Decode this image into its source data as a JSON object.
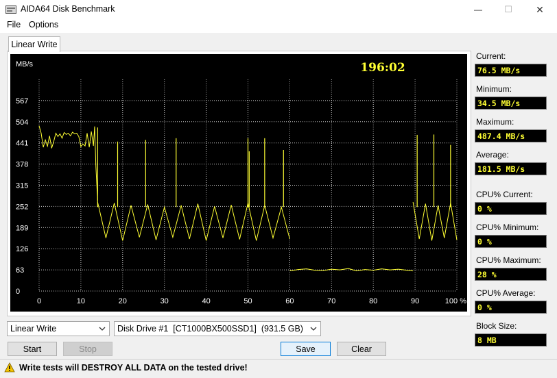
{
  "window": {
    "title": "AIDA64 Disk Benchmark",
    "controls": {
      "minimize": "—",
      "maximize": "☐",
      "close": "✕"
    }
  },
  "menu": {
    "file": "File",
    "options": "Options"
  },
  "tab": {
    "label": "Linear Write"
  },
  "chart_data": {
    "type": "line",
    "ylabel": "MB/s",
    "timer": "196:02",
    "ylim": [
      0,
      630
    ],
    "xlim": [
      0,
      100
    ],
    "yticks": [
      "567",
      "504",
      "441",
      "378",
      "315",
      "252",
      "189",
      "126",
      "63",
      "0"
    ],
    "ytick_values": [
      567,
      504,
      441,
      378,
      315,
      252,
      189,
      126,
      63,
      0
    ],
    "xticks": [
      "0",
      "10",
      "20",
      "30",
      "40",
      "50",
      "60",
      "70",
      "80",
      "90",
      "100 %"
    ],
    "xtick_values": [
      0,
      10,
      20,
      30,
      40,
      50,
      60,
      70,
      80,
      90,
      100
    ],
    "grid": true,
    "colors": {
      "background": "#000000",
      "grid": "#ffffff",
      "line": "#ffff33",
      "timer": "#ffff33",
      "axis_text": "#ffffff"
    },
    "series": [
      {
        "segments": [
          {
            "x": [
              0,
              0.5,
              1,
              1.5,
              2,
              2.5,
              3,
              3.5,
              4,
              4.5,
              5,
              5.5,
              6,
              6.5,
              7,
              7.5,
              8,
              8.5,
              9,
              9.5,
              10,
              10.5,
              11,
              11.5,
              12,
              12.5,
              13,
              13.3,
              13.6,
              14.0
            ],
            "y": [
              492,
              470,
              428,
              450,
              431,
              462,
              425,
              445,
              470,
              460,
              468,
              455,
              472,
              466,
              470,
              462,
              473,
              468,
              470,
              460,
              430,
              438,
              432,
              470,
              428,
              475,
              432,
              490,
              370,
              270
            ]
          },
          {
            "x": [
              14,
              16,
              18,
              20,
              22,
              24,
              26,
              28,
              30,
              32,
              34,
              36,
              38,
              40,
              42,
              44,
              46,
              48,
              50,
              52,
              54,
              56,
              58,
              60
            ],
            "y": [
              265,
              158,
              262,
              150,
              255,
              160,
              258,
              152,
              250,
              160,
              255,
              155,
              260,
              150,
              252,
              158,
              256,
              154,
              262,
              150,
              255,
              158,
              250,
              155
            ]
          },
          {
            "x": [
              60,
              62,
              64,
              66,
              68,
              70,
              72,
              74,
              76,
              78,
              80,
              82,
              84,
              86,
              88,
              89.5
            ],
            "y": [
              60,
              64,
              66,
              62,
              61,
              65,
              63,
              67,
              60,
              64,
              62,
              66,
              63,
              65,
              62,
              60
            ]
          },
          {
            "x": [
              89.5,
              91,
              92.5,
              94,
              95.5,
              97,
              98.5,
              100
            ],
            "y": [
              265,
              155,
              260,
              150,
              255,
              158,
              262,
              152
            ]
          }
        ],
        "spikes": [
          {
            "x": 14.0,
            "y": 487
          },
          {
            "x": 18.8,
            "y": 445
          },
          {
            "x": 25.5,
            "y": 450
          },
          {
            "x": 32.8,
            "y": 455
          },
          {
            "x": 50.0,
            "y": 455
          },
          {
            "x": 50.3,
            "y": 416
          },
          {
            "x": 54.0,
            "y": 455
          },
          {
            "x": 58.5,
            "y": 420
          },
          {
            "x": 90.5,
            "y": 465
          },
          {
            "x": 94.5,
            "y": 466
          },
          {
            "x": 98.5,
            "y": 435
          }
        ]
      }
    ]
  },
  "stats": {
    "current": {
      "label": "Current:",
      "value": "76.5 MB/s"
    },
    "minimum": {
      "label": "Minimum:",
      "value": "34.5 MB/s"
    },
    "maximum": {
      "label": "Maximum:",
      "value": "487.4 MB/s"
    },
    "average": {
      "label": "Average:",
      "value": "181.5 MB/s"
    },
    "cpu_current": {
      "label": "CPU% Current:",
      "value": "0 %"
    },
    "cpu_minimum": {
      "label": "CPU% Minimum:",
      "value": "0 %"
    },
    "cpu_maximum": {
      "label": "CPU% Maximum:",
      "value": "28 %"
    },
    "cpu_average": {
      "label": "CPU% Average:",
      "value": "0 %"
    },
    "block_size": {
      "label": "Block Size:",
      "value": "8 MB"
    }
  },
  "controls": {
    "test_select": "Linear Write",
    "drive_select": "Disk Drive #1  [CT1000BX500SSD1]  (931.5 GB)",
    "start": "Start",
    "stop": "Stop",
    "save": "Save",
    "clear": "Clear"
  },
  "warning": {
    "text": "Write tests will DESTROY ALL DATA on the tested drive!"
  }
}
